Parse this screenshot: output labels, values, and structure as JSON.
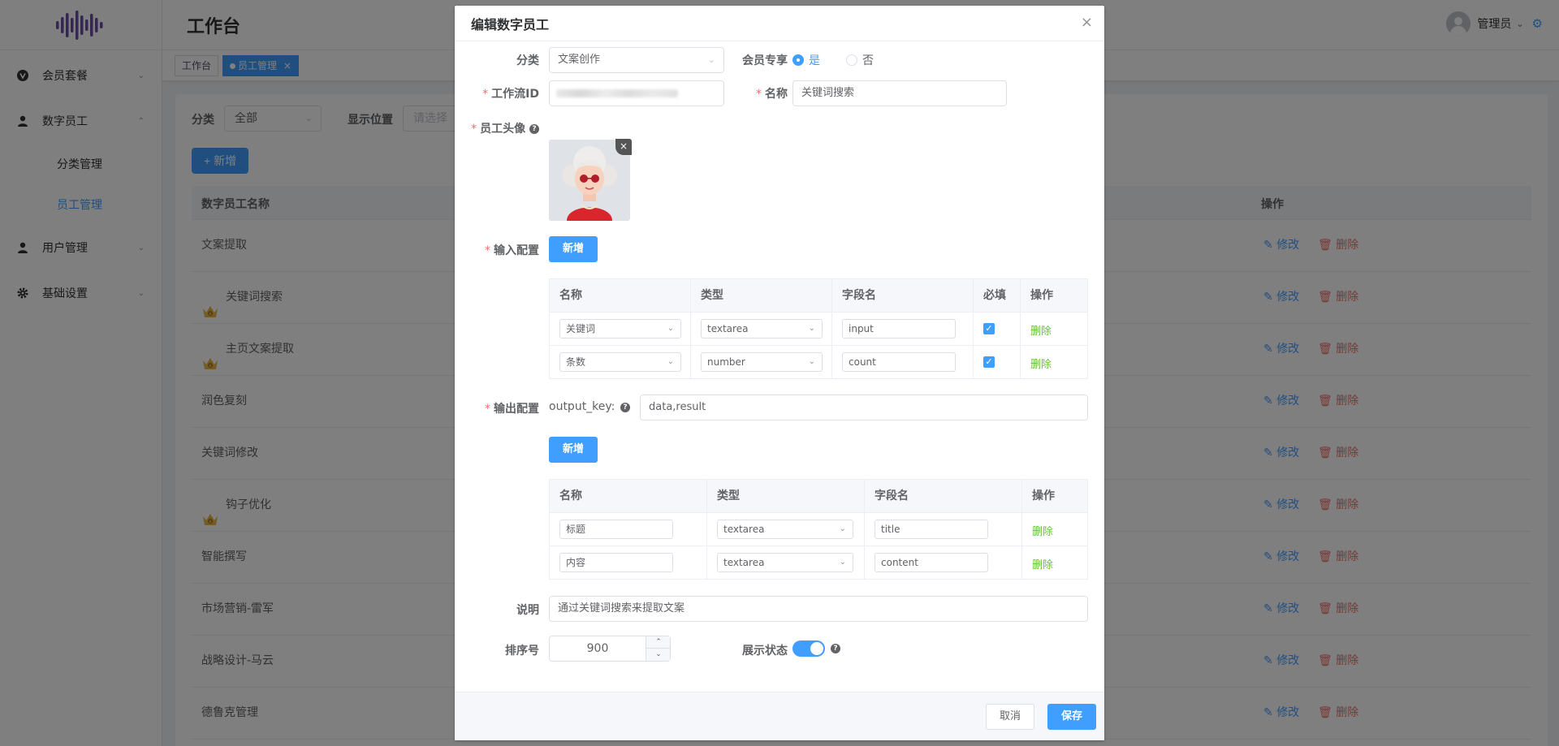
{
  "colors": {
    "primary": "#409eff",
    "danger": "#f56c6c",
    "success": "#67c23a",
    "logo": "#6a4ca8"
  },
  "header": {
    "title": "工作台",
    "user_name": "管理员"
  },
  "sidebar": {
    "items": [
      {
        "label": "会员套餐",
        "icon": "v-badge-icon"
      },
      {
        "label": "数字员工",
        "icon": "user-icon",
        "children": [
          "分类管理",
          "员工管理"
        ],
        "active_child": "员工管理"
      },
      {
        "label": "用户管理",
        "icon": "user-icon"
      },
      {
        "label": "基础设置",
        "icon": "gear-icon"
      }
    ]
  },
  "tags": [
    {
      "label": "工作台"
    },
    {
      "label": "员工管理",
      "active": true
    }
  ],
  "list": {
    "filter_category_label": "分类",
    "filter_category_value": "全部",
    "filter_position_label": "显示位置",
    "filter_position_placeholder": "请选择",
    "add_button": "新增",
    "col_name": "数字员工名称",
    "col_actions": "操作",
    "edit_label": "修改",
    "delete_label": "删除",
    "rows": [
      {
        "name": "文案提取",
        "vip": false
      },
      {
        "name": "关键词搜索",
        "vip": true
      },
      {
        "name": "主页文案提取",
        "vip": true
      },
      {
        "name": "润色复刻",
        "vip": false
      },
      {
        "name": "关键词修改",
        "vip": false
      },
      {
        "name": "钩子优化",
        "vip": true
      },
      {
        "name": "智能撰写",
        "vip": false
      },
      {
        "name": "市场营销-雷军",
        "vip": false
      },
      {
        "name": "战略设计-马云",
        "vip": false
      },
      {
        "name": "德鲁克管理",
        "vip": false
      }
    ]
  },
  "dialog": {
    "title": "编辑数字员工",
    "category_label": "分类",
    "category_value": "文案创作",
    "member_only_label": "会员专享",
    "member_yes": "是",
    "member_no": "否",
    "workflow_label": "工作流ID",
    "name_label": "名称",
    "name_value": "关键词搜索",
    "avatar_label": "员工头像",
    "input_config_label": "输入配置",
    "add_button": "新增",
    "input_headers": [
      "名称",
      "类型",
      "字段名",
      "必填",
      "操作"
    ],
    "input_rows": [
      {
        "name": "关键词",
        "type": "textarea",
        "field": "input",
        "required": true
      },
      {
        "name": "条数",
        "type": "number",
        "field": "count",
        "required": true
      }
    ],
    "output_config_label": "输出配置",
    "output_key_label": "output_key:",
    "output_key_value": "data,result",
    "output_headers": [
      "名称",
      "类型",
      "字段名",
      "操作"
    ],
    "output_rows": [
      {
        "name": "标题",
        "type": "textarea",
        "field": "title"
      },
      {
        "name": "内容",
        "type": "textarea",
        "field": "content"
      }
    ],
    "delete_label": "删除",
    "desc_label": "说明",
    "desc_value": "通过关键词搜索来提取文案",
    "sort_label": "排序号",
    "sort_value": "900",
    "display_label": "展示状态",
    "display_on": true,
    "cancel": "取消",
    "save": "保存"
  }
}
